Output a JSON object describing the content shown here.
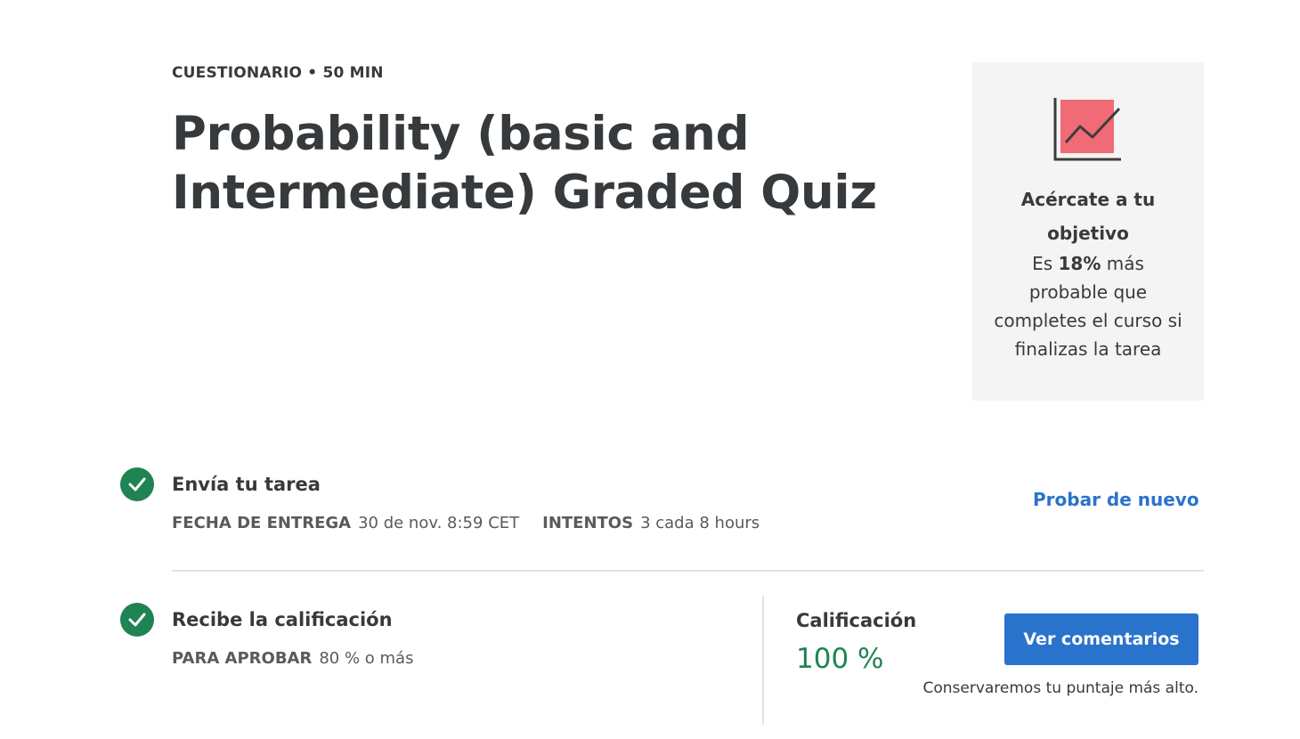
{
  "header": {
    "eyebrow": "CUESTIONARIO • 50 MIN",
    "title": "Probability (basic and Intermediate) Graded Quiz"
  },
  "goal_card": {
    "icon": "trend-chart-icon",
    "heading": "Acércate a tu objetivo",
    "text_prefix": "Es ",
    "text_highlight": "18%",
    "text_suffix": " más probable que completes el curso si finalizas la tarea",
    "icon_fill_color": "#f06b75"
  },
  "submit_step": {
    "icon": "check-circle-icon",
    "title": "Envía tu tarea",
    "due_label": "FECHA DE ENTREGA",
    "due_value": "30 de nov. 8:59 CET",
    "attempts_label": "INTENTOS",
    "attempts_value": "3 cada 8 hours",
    "retry_link": "Probar de nuevo"
  },
  "grade_step": {
    "icon": "check-circle-icon",
    "title": "Recibe la calificación",
    "pass_label": "PARA APROBAR",
    "pass_value": "80 % o más",
    "grade_label": "Calificación",
    "grade_value": "100 %",
    "feedback_button": "Ver comentarios",
    "keep_note": "Conservaremos tu puntaje más alto."
  },
  "colors": {
    "success": "#1f8354",
    "link": "#2a73cc",
    "card_bg": "#f4f4f4"
  }
}
